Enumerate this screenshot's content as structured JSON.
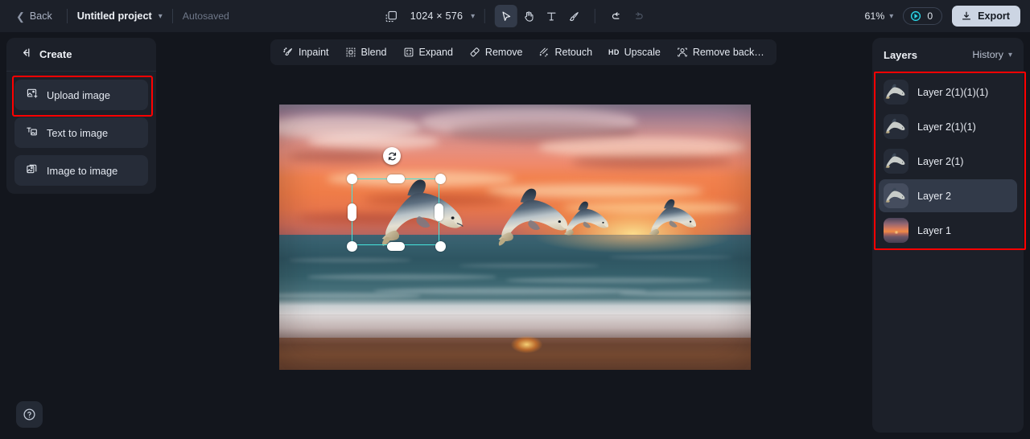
{
  "topbar": {
    "back_label": "Back",
    "back_icon": "chevron-left-icon",
    "project_name": "Untitled project",
    "project_chevron_icon": "chevron-down-icon",
    "autosaved_label": "Autosaved",
    "canvas_size_icon": "canvas-resize-icon",
    "canvas_dimensions": "1024 × 576",
    "dimensions_chevron_icon": "chevron-down-icon",
    "tools": [
      {
        "name": "select-tool",
        "icon": "cursor-arrow-icon",
        "active": true
      },
      {
        "name": "hand-tool",
        "icon": "hand-icon",
        "active": false
      },
      {
        "name": "text-tool",
        "icon": "text-t-icon",
        "active": false
      },
      {
        "name": "brush-tool",
        "icon": "paint-brush-icon",
        "active": false
      }
    ],
    "undo_icon": "undo-arrow-icon",
    "redo_icon": "redo-arrow-icon",
    "zoom_level": "61%",
    "zoom_chevron_icon": "chevron-down-icon",
    "credits_icon": "credit-coin-icon",
    "credits_count": "0",
    "export_label": "Export",
    "export_icon": "download-icon"
  },
  "left_panel": {
    "collapse_icon": "collapse-panel-left-icon",
    "title": "Create",
    "items": [
      {
        "label": "Upload image",
        "icon": "upload-image-icon",
        "highlighted": true
      },
      {
        "label": "Text to image",
        "icon": "text-to-image-icon",
        "highlighted": false
      },
      {
        "label": "Image to image",
        "icon": "image-to-image-icon",
        "highlighted": false
      }
    ]
  },
  "canvas_toolbar": {
    "items": [
      {
        "label": "Inpaint",
        "icon": "inpaint-brush-icon"
      },
      {
        "label": "Blend",
        "icon": "blend-icon"
      },
      {
        "label": "Expand",
        "icon": "expand-icon"
      },
      {
        "label": "Remove",
        "icon": "eraser-icon"
      },
      {
        "label": "Retouch",
        "icon": "retouch-icon"
      },
      {
        "label": "Upscale",
        "icon": "hd-upscale-icon",
        "tag": "HD"
      },
      {
        "label": "Remove back…",
        "icon": "remove-background-icon"
      }
    ]
  },
  "canvas": {
    "artwork_description": "Sunset beach with ocean waves and four jumping dolphins",
    "selection": {
      "rotate_icon": "rotate-handle-icon",
      "handle_count": 8,
      "accent_color": "#46e3dc"
    }
  },
  "right_panel": {
    "title": "Layers",
    "history_label": "History",
    "history_chevron_icon": "chevron-down-icon",
    "layers": [
      {
        "name": "Layer 2(1)(1)(1)",
        "thumb": "dolphin",
        "selected": false
      },
      {
        "name": "Layer 2(1)(1)",
        "thumb": "dolphin",
        "selected": false
      },
      {
        "name": "Layer 2(1)",
        "thumb": "dolphin",
        "selected": false
      },
      {
        "name": "Layer 2",
        "thumb": "dolphin",
        "selected": true
      },
      {
        "name": "Layer 1",
        "thumb": "sunset",
        "selected": false
      }
    ]
  },
  "help": {
    "icon": "help-question-icon"
  },
  "annotations": {
    "color": "#ff0000",
    "boxes": [
      {
        "target": "upload-image-button"
      },
      {
        "target": "layers-list"
      }
    ]
  }
}
